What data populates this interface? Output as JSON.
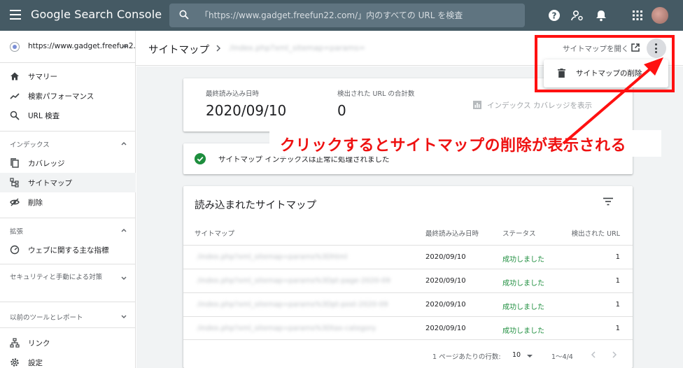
{
  "topbar": {
    "brand": "Google Search Console",
    "search_placeholder": "「https://www.gadget.freefun22.com/」内のすべての URL を検査"
  },
  "sidebar": {
    "property": "https://www.gadget.freefun2...",
    "items_top": [
      {
        "label": "サマリー",
        "icon": "home-icon"
      },
      {
        "label": "検索パフォーマンス",
        "icon": "trending-icon"
      },
      {
        "label": "URL 検査",
        "icon": "search-icon"
      }
    ],
    "section_index": "インデックス",
    "items_index": [
      {
        "label": "カバレッジ",
        "icon": "copy-icon"
      },
      {
        "label": "サイトマップ",
        "icon": "sitemap-icon"
      },
      {
        "label": "削除",
        "icon": "eye-off-icon"
      }
    ],
    "section_ext": "拡張",
    "items_ext": [
      {
        "label": "ウェブに関する主な指標",
        "icon": "gauge-icon"
      }
    ],
    "section_security": "セキュリティと手動による対策",
    "section_legacy": "以前のツールとレポート",
    "items_bottom": [
      {
        "label": "リンク",
        "icon": "links-icon"
      },
      {
        "label": "設定",
        "icon": "gear-icon"
      }
    ]
  },
  "header": {
    "title": "サイトマップ",
    "crumb_path": "/index.php?xml_sitemap=params=",
    "open_link": "サイトマップを開く"
  },
  "menu": {
    "delete_label": "サイトマップの削除"
  },
  "stats": {
    "last_read_label": "最終読み込み日時",
    "last_read_value": "2020/09/10",
    "url_count_label": "検出された URL の合計数",
    "url_count_value": "0",
    "coverage_link": "インデックス カバレッジを表示"
  },
  "status_message": "サイトマップ インデックスは正常に処理されました",
  "table": {
    "title": "読み込まれたサイトマップ",
    "headers": [
      "サイトマップ",
      "最終読み込み日時",
      "ステータス",
      "検出された URL"
    ],
    "rows": [
      {
        "sitemap": "/index.php?xml_sitemap=params%3Dhtml",
        "date": "2020/09/10",
        "status": "成功しました",
        "count": "1"
      },
      {
        "sitemap": "/index.php?xml_sitemap=params%3Dpt-page-2020-09",
        "date": "2020/09/10",
        "status": "成功しました",
        "count": "1"
      },
      {
        "sitemap": "/index.php?xml_sitemap=params%3Dpt-post-2020-09",
        "date": "2020/09/10",
        "status": "成功しました",
        "count": "1"
      },
      {
        "sitemap": "/index.php?xml_sitemap=params%3Dtax-category",
        "date": "2020/09/10",
        "status": "成功しました",
        "count": "1"
      }
    ],
    "rows_per_page_label": "1 ページあたりの行数:",
    "rows_per_page": "10",
    "range": "1〜4/4"
  },
  "annotation": {
    "text": "クリックするとサイトマップの削除が表示される",
    "color": "#ee1111"
  }
}
